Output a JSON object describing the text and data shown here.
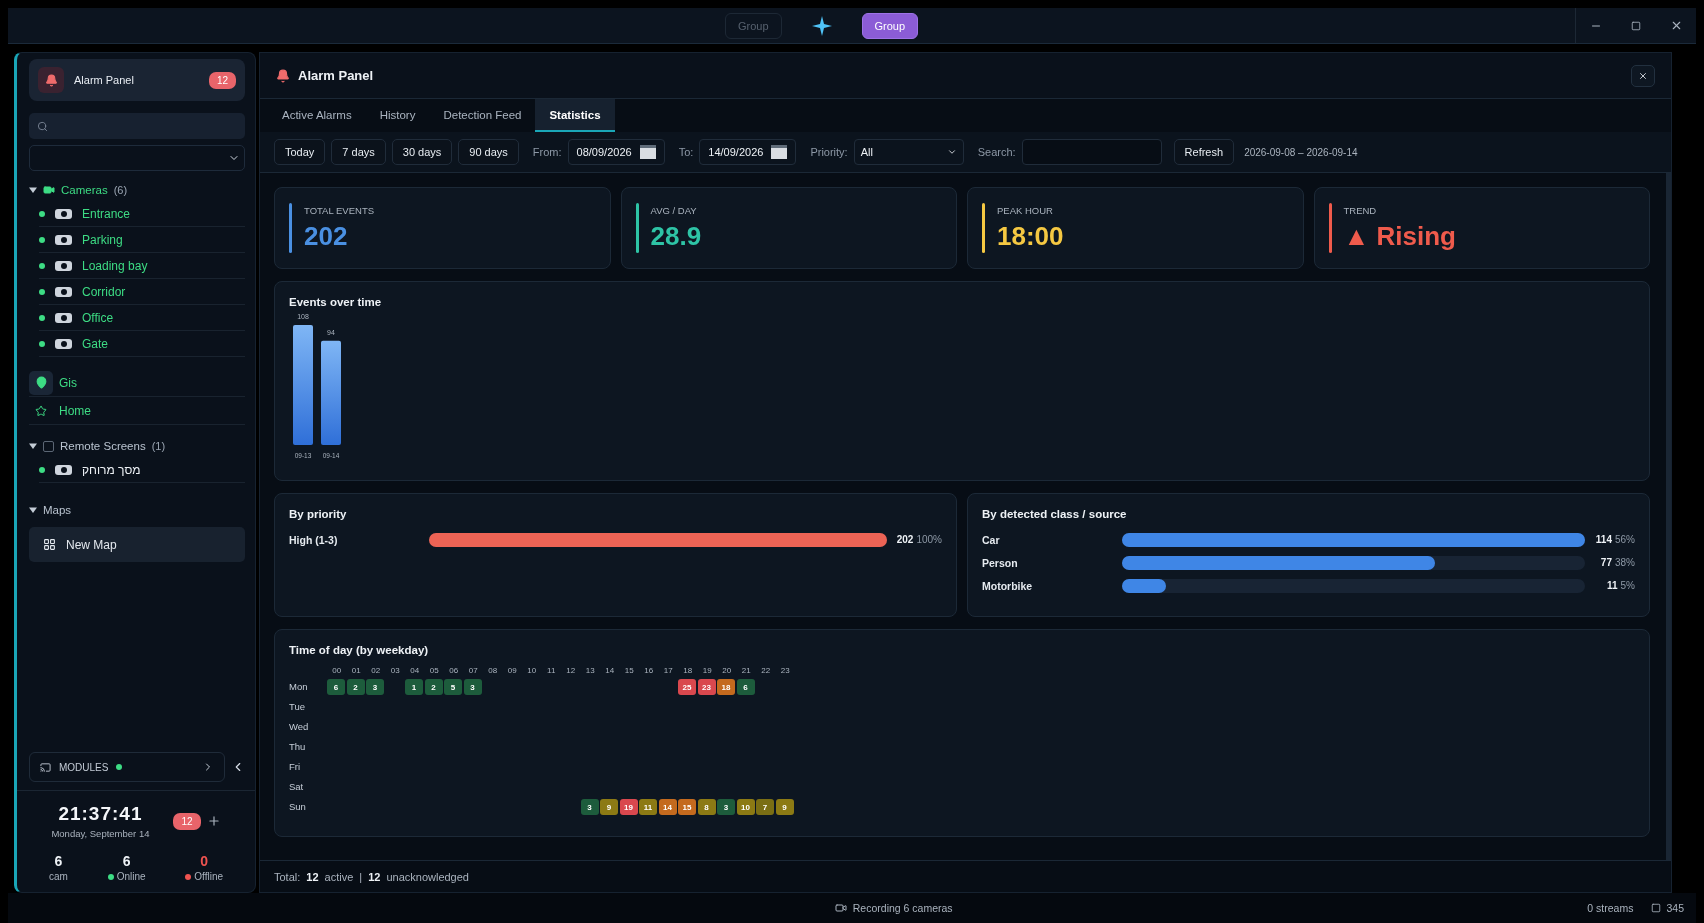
{
  "titlebar": {
    "buttons": [
      {
        "label": "Group",
        "selected": false
      },
      {
        "label": "Group",
        "selected": true
      }
    ]
  },
  "sidebar": {
    "header": {
      "title": "Alarm Panel",
      "badge": "12"
    },
    "tree": [
      {
        "kind": "group",
        "label": "Cameras",
        "count": "(6)",
        "expanded": true,
        "children": [
          {
            "label": "Entrance",
            "online": true
          },
          {
            "label": "Parking",
            "online": true
          },
          {
            "label": "Loading bay",
            "online": true
          },
          {
            "label": "Corridor",
            "online": true
          },
          {
            "label": "Office",
            "online": true
          },
          {
            "label": "Gate",
            "online": true
          }
        ]
      },
      {
        "kind": "location",
        "label": "Gis",
        "selected": true
      },
      {
        "kind": "favorite",
        "label": "Home",
        "selected": false
      },
      {
        "kind": "group",
        "label": "Remote Screens",
        "count": "(1)",
        "expanded": true,
        "checked": false,
        "children": [
          {
            "label": "מסך מרוחק",
            "online": true
          }
        ]
      },
      {
        "kind": "maps",
        "label": "Maps",
        "expanded": true,
        "children": [
          {
            "label": "New Map"
          }
        ]
      }
    ],
    "modules": {
      "label": "MODULES",
      "online": true
    },
    "clock": {
      "time": "21:37:41",
      "date": "Monday, September 14",
      "badge": "12"
    },
    "stats": [
      {
        "value": "6",
        "label": "cam"
      },
      {
        "value": "6",
        "label": "Online",
        "color": "#3ddc84"
      },
      {
        "value": "0",
        "label": "Offline",
        "color": "#ef5350"
      }
    ]
  },
  "panel": {
    "title": "Alarm Panel",
    "tabs": [
      {
        "label": "Active Alarms",
        "selected": false
      },
      {
        "label": "History",
        "selected": false
      },
      {
        "label": "Detection Feed",
        "selected": false
      },
      {
        "label": "Statistics",
        "selected": true
      }
    ],
    "toolbar": {
      "ranges": [
        "Today",
        "7 days",
        "30 days",
        "90 days"
      ],
      "from_label": "From:",
      "from": "08/09/2026",
      "to_label": "To:",
      "to": "14/09/2026",
      "priority_label": "Priority:",
      "priority": "All",
      "search_label": "Search:",
      "refresh": "Refresh",
      "range_text": "2026-09-08 – 2026-09-14"
    },
    "cards": [
      {
        "label": "TOTAL EVENTS",
        "value": "202",
        "color": "#4a90e2"
      },
      {
        "label": "AVG / DAY",
        "value": "28.9",
        "color": "#2ec4a6"
      },
      {
        "label": "PEAK HOUR",
        "value": "18:00",
        "color": "#f5c842"
      },
      {
        "label": "TREND",
        "value": "▲ Rising",
        "color": "#ef5b4c"
      }
    ],
    "events": {
      "chart_data": {
        "type": "bar",
        "title": "Events over time",
        "categories": [
          "09-13",
          "09-14"
        ],
        "values": [
          108,
          94
        ],
        "data_labels": true
      }
    },
    "priority": {
      "title": "By priority",
      "rows": [
        {
          "label": "High (1-3)",
          "count": "202",
          "percent": "100%",
          "level": 1
        }
      ]
    },
    "classes": {
      "title": "By detected class / source",
      "rows": [
        {
          "label": "Car",
          "count": "114",
          "percent": "56%",
          "level": 1
        },
        {
          "label": "Person",
          "count": "77",
          "percent": "38%",
          "level": 0.675
        },
        {
          "label": "Motorbike",
          "count": "11",
          "percent": "5%",
          "level": 0.096
        }
      ]
    },
    "heatmap": {
      "title": "Time of day (by weekday)",
      "hours": [
        "00",
        "01",
        "02",
        "03",
        "04",
        "05",
        "06",
        "07",
        "08",
        "09",
        "10",
        "11",
        "12",
        "13",
        "14",
        "15",
        "16",
        "17",
        "18",
        "19",
        "20",
        "21",
        "22",
        "23"
      ],
      "rows": [
        {
          "day": "Mon",
          "cells": [
            {
              "value": "6",
              "color": "#1d5c3c"
            },
            {
              "value": "2",
              "color": "#1d5c3c"
            },
            {
              "value": "3",
              "color": "#1d5c3c"
            },
            null,
            {
              "value": "1",
              "color": "#1d5c3c"
            },
            {
              "value": "2",
              "color": "#1d5c3c"
            },
            {
              "value": "5",
              "color": "#1d5c3c"
            },
            {
              "value": "3",
              "color": "#1d5c3c"
            },
            null,
            null,
            null,
            null,
            null,
            null,
            null,
            null,
            null,
            null,
            {
              "value": "25",
              "color": "#d9484e"
            },
            {
              "value": "23",
              "color": "#d9484e"
            },
            {
              "value": "18",
              "color": "#c46a1e"
            },
            {
              "value": "6",
              "color": "#1d5c3c"
            },
            null,
            null
          ]
        },
        {
          "day": "Tue",
          "cells": []
        },
        {
          "day": "Wed",
          "cells": []
        },
        {
          "day": "Thu",
          "cells": []
        },
        {
          "day": "Fri",
          "cells": []
        },
        {
          "day": "Sat",
          "cells": []
        },
        {
          "day": "Sun",
          "cells": [
            null,
            null,
            null,
            null,
            null,
            null,
            null,
            null,
            null,
            null,
            null,
            null,
            null,
            {
              "value": "3",
              "color": "#1d5c3c"
            },
            {
              "value": "9",
              "color": "#8c7a14"
            },
            {
              "value": "19",
              "color": "#d9484e"
            },
            {
              "value": "11",
              "color": "#8c7a14"
            },
            {
              "value": "14",
              "color": "#c46a1e"
            },
            {
              "value": "15",
              "color": "#c46a1e"
            },
            {
              "value": "8",
              "color": "#8c7a14"
            },
            {
              "value": "3",
              "color": "#1d5c3c"
            },
            {
              "value": "10",
              "color": "#8c7a14"
            },
            {
              "value": "7",
              "color": "#7a6e14"
            },
            {
              "value": "9",
              "color": "#8c7a14"
            }
          ]
        }
      ]
    },
    "footer": {
      "label": "Total:",
      "active_count": "12",
      "active": "active",
      "separator": "|",
      "unack_count": "12",
      "unack": "unacknowledged"
    }
  },
  "status_bar": {
    "recording": "Recording 6 cameras",
    "streams": "0 streams",
    "count": "345"
  }
}
